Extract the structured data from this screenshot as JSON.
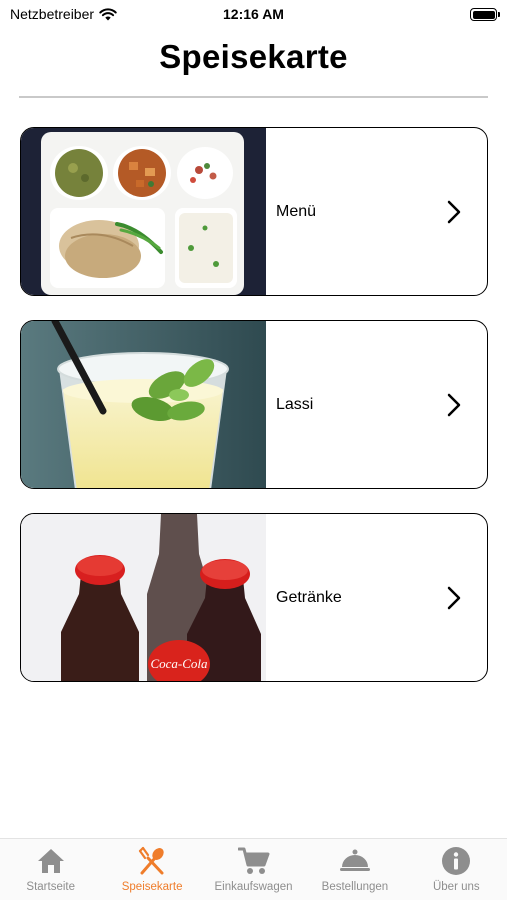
{
  "status_bar": {
    "carrier": "Netzbetreiber",
    "time": "12:16 AM"
  },
  "page": {
    "title": "Speisekarte"
  },
  "menu_items": [
    {
      "label": "Menü"
    },
    {
      "label": "Lassi"
    },
    {
      "label": "Getränke"
    }
  ],
  "image_text": {
    "bottle_cap_logo": "Coca-Cola"
  },
  "tab_bar": {
    "active_color": "#ef7d2b",
    "inactive_color": "#8e8e8e",
    "tabs": [
      {
        "label": "Startseite",
        "icon": "home-icon"
      },
      {
        "label": "Speisekarte",
        "icon": "fork-spoon-icon",
        "active": true
      },
      {
        "label": "Einkaufswagen",
        "icon": "cart-icon"
      },
      {
        "label": "Bestellungen",
        "icon": "cloche-icon"
      },
      {
        "label": "Über uns",
        "icon": "info-icon"
      }
    ]
  }
}
